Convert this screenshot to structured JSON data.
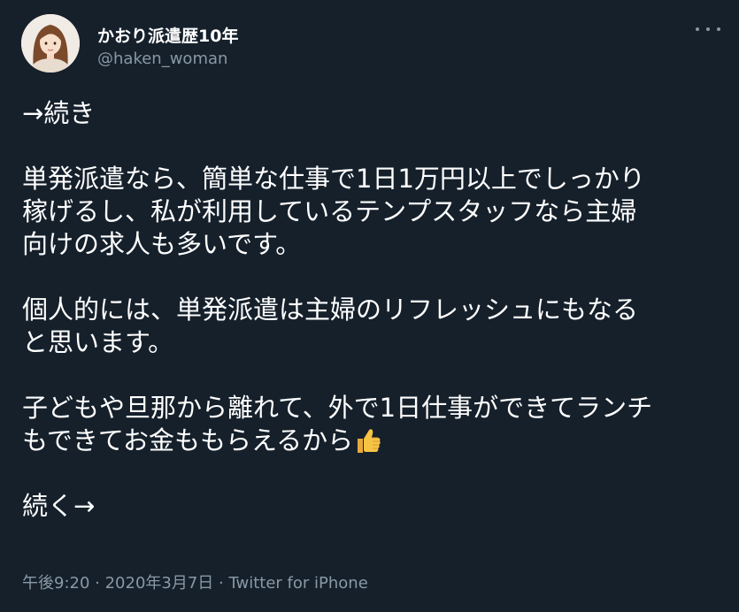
{
  "tweet": {
    "display_name": "かおり派遣歴10年",
    "handle": "@haken_woman",
    "more_icon": "more-dots-icon",
    "lines": [
      "→続き",
      "",
      "単発派遣なら、簡単な仕事で1日1万円以上でしっかり",
      "稼げるし、私が利用しているテンプスタッフなら主婦",
      "向けの求人も多いです。",
      "",
      "個人的には、単発派遣は主婦のリフレッシュにもなる",
      "と思います。",
      "",
      "子どもや旦那から離れて、外で1日仕事ができてランチ",
      "もできてお金ももらえるから",
      "",
      "続く→"
    ],
    "emoji": "thumbs-up-icon",
    "timestamp": "午後9:20 · 2020年3月7日",
    "separator": " · ",
    "source": "Twitter for iPhone"
  },
  "colors": {
    "background": "#15202b",
    "text": "#ffffff",
    "secondary": "#8899a6"
  }
}
